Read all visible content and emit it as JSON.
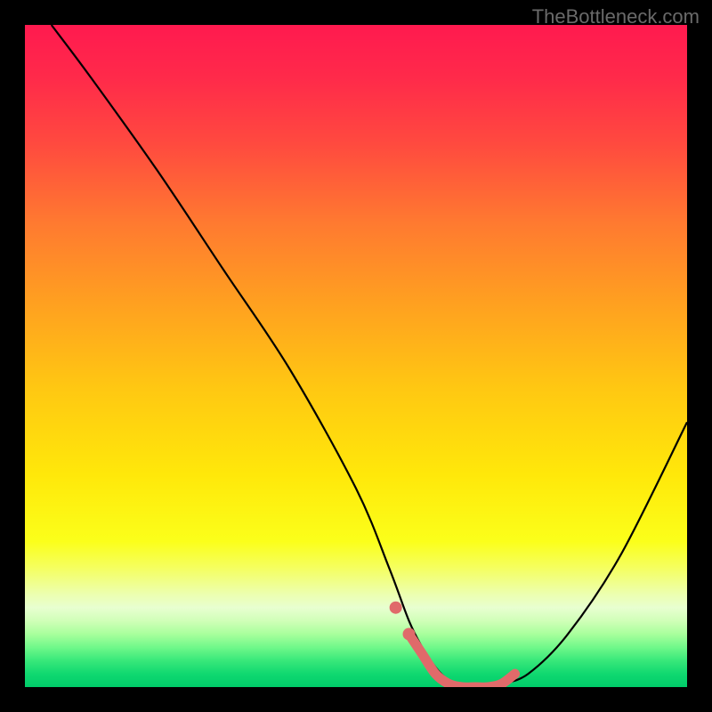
{
  "watermark": "TheBottleneck.com",
  "chart_data": {
    "type": "line",
    "title": "",
    "xlabel": "",
    "ylabel": "",
    "xlim": [
      0,
      100
    ],
    "ylim": [
      0,
      100
    ],
    "series": [
      {
        "name": "bottleneck-curve",
        "x": [
          4,
          10,
          20,
          30,
          40,
          50,
          55,
          58,
          60,
          62,
          64,
          66,
          68,
          70,
          72,
          76,
          82,
          90,
          100
        ],
        "y": [
          100,
          92,
          78,
          63,
          48,
          30,
          18,
          10,
          6,
          3,
          1,
          0,
          0,
          0,
          0.5,
          2,
          8,
          20,
          40
        ]
      }
    ],
    "highlight": {
      "name": "valley-marker",
      "color": "#e06a6a",
      "x": [
        58,
        60,
        62,
        64,
        66,
        68,
        70,
        72,
        74
      ],
      "y": [
        8,
        5,
        2,
        0.5,
        0,
        0,
        0,
        0.5,
        2
      ]
    }
  }
}
